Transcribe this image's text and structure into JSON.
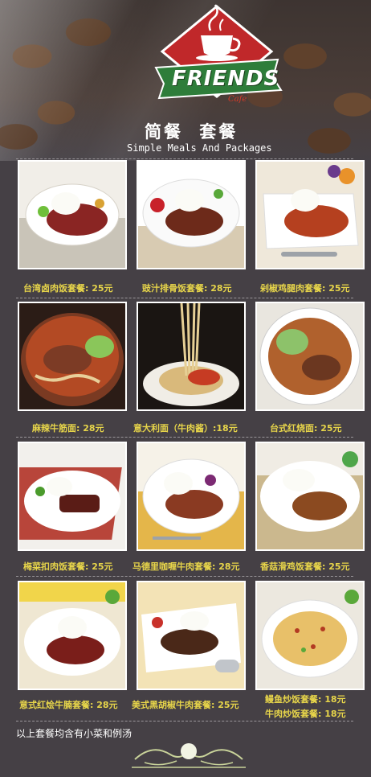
{
  "brand": {
    "name": "FRIENDS",
    "sub": "Cafe"
  },
  "heading": {
    "cn": "简餐  套餐",
    "en": "Simple Meals And Packages"
  },
  "items": [
    {
      "label": "台湾卤肉饭套餐: 25元",
      "image": "braised-pork-rice-photo"
    },
    {
      "label": "豉汁排骨饭套餐: 28元",
      "image": "black-bean-spareribs-rice-photo"
    },
    {
      "label": "剁椒鸡腿肉套餐: 25元",
      "image": "chopped-chili-chicken-leg-photo"
    },
    {
      "label": "麻辣牛筋面: 28元",
      "image": "spicy-beef-tendon-noodles-photo"
    },
    {
      "label": "意大利面（牛肉酱）:18元",
      "image": "spaghetti-beef-sauce-photo"
    },
    {
      "label": "台式红烧面: 25元",
      "image": "taiwanese-braised-noodles-photo"
    },
    {
      "label": "梅菜扣肉饭套餐: 25元",
      "image": "preserved-vegetable-pork-rice-photo"
    },
    {
      "label": "马德里咖喱牛肉套餐: 28元",
      "image": "madrid-curry-beef-photo"
    },
    {
      "label": "香菇滑鸡饭套餐: 25元",
      "image": "mushroom-chicken-rice-photo"
    },
    {
      "label": "意式红烩牛腩套餐: 28元",
      "image": "italian-braised-brisket-photo"
    },
    {
      "label": "美式黑胡椒牛肉套餐: 25元",
      "image": "american-black-pepper-beef-photo"
    },
    {
      "label": "鳗鱼炒饭套餐: 18元",
      "image": "eel-fried-rice-photo"
    }
  ],
  "extra_label": "牛肉炒饭套餐: 18元",
  "footer_note": "以上套餐均含有小菜和例汤",
  "colors": {
    "background": "#454045",
    "label": "#e7d54a",
    "logo_red": "#c0282a",
    "logo_green": "#2e7d3a"
  }
}
